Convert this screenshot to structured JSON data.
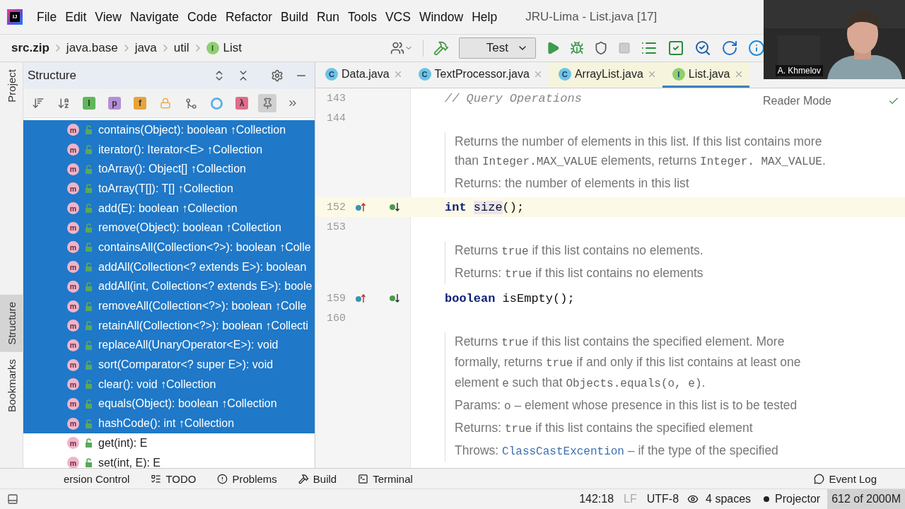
{
  "app_glyph": "IJ",
  "menu_bar": {
    "items": [
      "File",
      "Edit",
      "View",
      "Navigate",
      "Code",
      "Refactor",
      "Build",
      "Run",
      "Tools",
      "VCS",
      "Window",
      "Help"
    ],
    "title": "JRU-Lima - List.java [17]"
  },
  "breadcrumbs": [
    {
      "label": "src.zip",
      "root": true
    },
    {
      "label": "java.base",
      "root": false
    },
    {
      "label": "java",
      "root": false
    },
    {
      "label": "util",
      "root": false
    },
    {
      "label": "List",
      "root": false,
      "glyph": "I"
    }
  ],
  "run_config": "Test",
  "side_tabs": [
    {
      "label": "Project",
      "selected": false
    },
    {
      "label": "Structure",
      "selected": true
    },
    {
      "label": "Bookmarks",
      "selected": false
    }
  ],
  "structure": {
    "title": "Structure",
    "filters": [
      {
        "kind": "sort-visibility"
      },
      {
        "kind": "sort-alpha"
      },
      {
        "kind": "letter",
        "glyph": "I",
        "color": "#5fb85a"
      },
      {
        "kind": "letter",
        "glyph": "p",
        "color": "#b48ed6"
      },
      {
        "kind": "letter",
        "glyph": "f",
        "color": "#e8a33d"
      },
      {
        "kind": "lock"
      },
      {
        "kind": "merge"
      },
      {
        "kind": "ring"
      },
      {
        "kind": "letter",
        "glyph": "λ",
        "color": "#e06c8a"
      },
      {
        "kind": "pin"
      },
      {
        "kind": "more"
      }
    ],
    "items": [
      {
        "badge": "m",
        "label": "contains(Object): boolean ↑Collection",
        "selected": true
      },
      {
        "badge": "m",
        "label": "iterator(): Iterator<E> ↑Collection",
        "selected": true
      },
      {
        "badge": "m",
        "label": "toArray(): Object[] ↑Collection",
        "selected": true
      },
      {
        "badge": "m",
        "label": "toArray(T[]): T[] ↑Collection",
        "selected": true
      },
      {
        "badge": "m",
        "label": "add(E): boolean ↑Collection",
        "selected": true
      },
      {
        "badge": "m",
        "label": "remove(Object): boolean ↑Collection",
        "selected": true
      },
      {
        "badge": "m",
        "label": "containsAll(Collection<?>): boolean ↑Colle",
        "selected": true
      },
      {
        "badge": "m",
        "label": "addAll(Collection<? extends E>): boolean",
        "selected": true
      },
      {
        "badge": "m",
        "label": "addAll(int, Collection<? extends E>): boole",
        "selected": true
      },
      {
        "badge": "m",
        "label": "removeAll(Collection<?>): boolean ↑Colle",
        "selected": true
      },
      {
        "badge": "m",
        "label": "retainAll(Collection<?>): boolean ↑Collecti",
        "selected": true
      },
      {
        "badge": "m",
        "label": "replaceAll(UnaryOperator<E>): void",
        "selected": true
      },
      {
        "badge": "m",
        "label": "sort(Comparator<? super E>): void",
        "selected": true
      },
      {
        "badge": "m",
        "label": "clear(): void ↑Collection",
        "selected": true
      },
      {
        "badge": "m",
        "label": "equals(Object): boolean ↑Collection",
        "selected": true
      },
      {
        "badge": "m",
        "label": "hashCode(): int ↑Collection",
        "selected": true
      },
      {
        "badge": "m",
        "label": "get(int): E",
        "selected": false
      },
      {
        "badge": "m",
        "label": "set(int, E): E",
        "selected": false
      }
    ]
  },
  "editor_tabs": [
    {
      "label": "Data.java",
      "glyph": "C",
      "library": false,
      "selected": false
    },
    {
      "label": "TextProcessor.java",
      "glyph": "C",
      "library": false,
      "selected": false
    },
    {
      "label": "ArrayList.java",
      "glyph": "C",
      "library": true,
      "selected": false
    },
    {
      "label": "List.java",
      "glyph": "I",
      "library": true,
      "selected": true
    }
  ],
  "reader_mode": "Reader Mode",
  "editor": [
    {
      "kind": "code",
      "number": "143",
      "marks": false,
      "current": false,
      "tokens": [
        {
          "kind": "comment",
          "text": "// Query Operations"
        }
      ]
    },
    {
      "kind": "code",
      "number": "144",
      "marks": false,
      "current": false
    },
    {
      "kind": "doc",
      "paragraphs": [
        [
          {
            "code": false,
            "text": "Returns the number of elements in this list. If this list contains more than "
          },
          {
            "code": true,
            "text": "Integer.MAX_VALUE"
          },
          {
            "code": false,
            "text": " elements, returns "
          },
          {
            "code": true,
            "text": "Integer. MAX_VALUE"
          },
          {
            "code": false,
            "text": "."
          }
        ],
        [
          {
            "code": false,
            "text": "Returns: the number of elements in this list"
          }
        ]
      ]
    },
    {
      "kind": "code",
      "number": "152",
      "marks": true,
      "current": true,
      "tokens": [
        {
          "kind": "keyword",
          "text": "int"
        },
        {
          "kind": "usage",
          "text": "size"
        },
        {
          "kind": "plain",
          "text": "();"
        }
      ]
    },
    {
      "kind": "code",
      "number": "153",
      "marks": false,
      "current": false
    },
    {
      "kind": "doc",
      "paragraphs": [
        [
          {
            "code": false,
            "text": "Returns "
          },
          {
            "code": true,
            "text": "true"
          },
          {
            "code": false,
            "text": " if this list contains no elements."
          }
        ],
        [
          {
            "code": false,
            "text": "Returns: "
          },
          {
            "code": true,
            "text": "true"
          },
          {
            "code": false,
            "text": " if this list contains no elements"
          }
        ]
      ]
    },
    {
      "kind": "code",
      "number": "159",
      "marks": true,
      "current": false,
      "tokens": [
        {
          "kind": "keyword",
          "text": "boolean"
        },
        {
          "kind": "plain",
          "text": "isEmpty();"
        }
      ]
    },
    {
      "kind": "code",
      "number": "160",
      "marks": false,
      "current": false
    },
    {
      "kind": "doc",
      "paragraphs": [
        [
          {
            "code": false,
            "text": "Returns "
          },
          {
            "code": true,
            "text": "true"
          },
          {
            "code": false,
            "text": " if this list contains the specified element. More formally, returns "
          },
          {
            "code": true,
            "text": "true"
          },
          {
            "code": false,
            "text": " if and only if this list contains at least one element "
          },
          {
            "code": true,
            "text": "e"
          },
          {
            "code": false,
            "text": " such that "
          },
          {
            "code": true,
            "text": "Objects.equals(o, e)"
          },
          {
            "code": false,
            "text": "."
          }
        ],
        [
          {
            "code": false,
            "text": "Params: "
          },
          {
            "code": true,
            "text": "o"
          },
          {
            "code": false,
            "text": " – element whose presence in this list is to be tested"
          }
        ],
        [
          {
            "code": false,
            "text": "Returns: "
          },
          {
            "code": true,
            "text": "true"
          },
          {
            "code": false,
            "text": " if this list contains the specified element"
          }
        ],
        [
          {
            "code": false,
            "text": "Throws: "
          },
          {
            "code": true,
            "text": "ClassCastExcention",
            "link": true
          },
          {
            "code": false,
            "text": " – if the type of the specified"
          }
        ]
      ]
    }
  ],
  "tool_windows": [
    {
      "kind": "none",
      "label": "ersion Control"
    },
    {
      "kind": "todo",
      "label": "TODO"
    },
    {
      "kind": "problems",
      "label": "Problems"
    },
    {
      "kind": "build",
      "label": "Build"
    },
    {
      "kind": "terminal",
      "label": "Terminal"
    }
  ],
  "event_log": "Event Log",
  "status_bar": {
    "position": "142:18",
    "line_separator": "LF",
    "encoding": "UTF-8",
    "indent": "4 spaces",
    "projector": "Projector",
    "memory": "612 of 2000M"
  },
  "webcam": {
    "name": "A. Khmelov"
  }
}
